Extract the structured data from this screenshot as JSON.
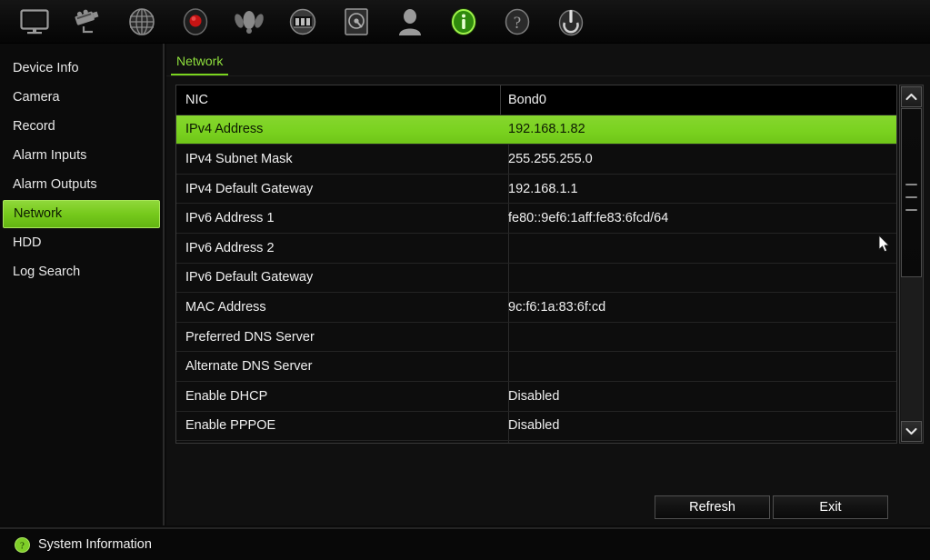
{
  "toolbar": {
    "items": [
      {
        "name": "monitor-icon",
        "label": "Display"
      },
      {
        "name": "camera-icon",
        "label": "Camera"
      },
      {
        "name": "globe-icon",
        "label": "Network Settings"
      },
      {
        "name": "record-icon",
        "label": "Record"
      },
      {
        "name": "motion-icon",
        "label": "Alarm"
      },
      {
        "name": "playback-icon",
        "label": "Playback"
      },
      {
        "name": "hdd-icon",
        "label": "HDD"
      },
      {
        "name": "user-icon",
        "label": "User"
      },
      {
        "name": "info-icon",
        "label": "System Information"
      },
      {
        "name": "help-icon",
        "label": "Help"
      },
      {
        "name": "power-icon",
        "label": "Shutdown"
      }
    ],
    "active_index": 8
  },
  "sidebar": {
    "items": [
      {
        "label": "Device Info",
        "active": false
      },
      {
        "label": "Camera",
        "active": false
      },
      {
        "label": "Record",
        "active": false
      },
      {
        "label": "Alarm Inputs",
        "active": false
      },
      {
        "label": "Alarm Outputs",
        "active": false
      },
      {
        "label": "Network",
        "active": true
      },
      {
        "label": "HDD",
        "active": false
      },
      {
        "label": "Log Search",
        "active": false
      }
    ]
  },
  "content": {
    "tab": {
      "label": "Network",
      "active": true
    }
  },
  "table": {
    "header": {
      "key": "NIC",
      "value": "Bond0"
    },
    "rows": [
      {
        "key": "IPv4 Address",
        "value": "192.168.1.82",
        "selected": true
      },
      {
        "key": "IPv4 Subnet Mask",
        "value": "255.255.255.0",
        "selected": false
      },
      {
        "key": "IPv4 Default Gateway",
        "value": "192.168.1.1",
        "selected": false
      },
      {
        "key": "IPv6 Address 1",
        "value": "fe80::9ef6:1aff:fe83:6fcd/64",
        "selected": false
      },
      {
        "key": "IPv6 Address 2",
        "value": "",
        "selected": false
      },
      {
        "key": "IPv6 Default Gateway",
        "value": "",
        "selected": false
      },
      {
        "key": "MAC Address",
        "value": "9c:f6:1a:83:6f:cd",
        "selected": false
      },
      {
        "key": "Preferred DNS Server",
        "value": "",
        "selected": false
      },
      {
        "key": "Alternate DNS Server",
        "value": "",
        "selected": false
      },
      {
        "key": "Enable DHCP",
        "value": "Disabled",
        "selected": false
      },
      {
        "key": "Enable PPPOE",
        "value": "Disabled",
        "selected": false
      }
    ]
  },
  "scrollbar": {
    "up_label": "Scroll up",
    "down_label": "Scroll down"
  },
  "buttons": {
    "refresh": "Refresh",
    "exit": "Exit"
  },
  "statusbar": {
    "icon": "info-circle-icon",
    "text": "System Information"
  },
  "colors": {
    "accent_green": "#7ad420",
    "tab_green": "#8ede3d",
    "background": "#0a0a0a",
    "panel": "#101010",
    "border": "#3a3a3a"
  }
}
